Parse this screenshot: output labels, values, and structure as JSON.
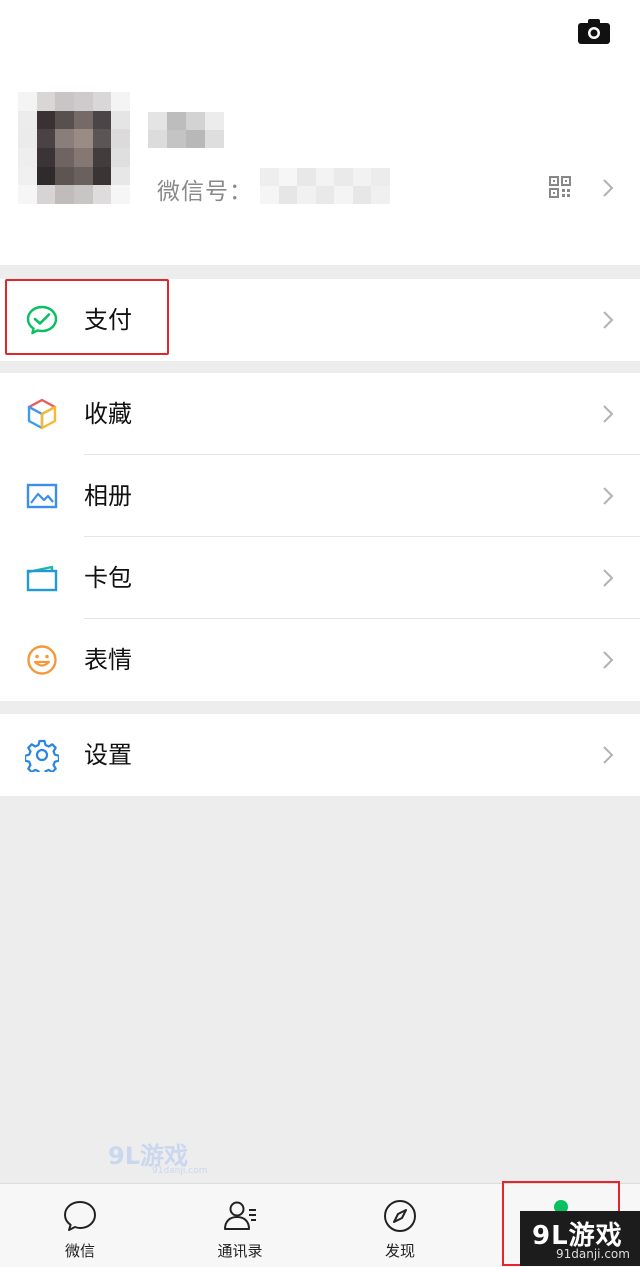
{
  "profile": {
    "wxid_label": "微信号：",
    "colors": {
      "background": "#ffffff"
    }
  },
  "pay_group": {
    "label": "支付"
  },
  "menu": {
    "items": [
      {
        "label": "收藏",
        "icon": "favorites-cube-icon"
      },
      {
        "label": "相册",
        "icon": "album-image-icon"
      },
      {
        "label": "卡包",
        "icon": "card-wallet-icon"
      },
      {
        "label": "表情",
        "icon": "sticker-smile-icon"
      }
    ]
  },
  "settings_group": {
    "label": "设置"
  },
  "tabbar": {
    "tabs": [
      {
        "label": "微信",
        "icon": "chat-bubble-icon"
      },
      {
        "label": "通讯录",
        "icon": "contacts-icon"
      },
      {
        "label": "发现",
        "icon": "compass-icon"
      }
    ]
  },
  "watermark": {
    "logo_text": "9L游戏",
    "logo_domain": "91danji.com",
    "corner_text": "9L游戏",
    "corner_domain": "91danji.com"
  },
  "colors": {
    "accent_green": "#07c160",
    "highlight_red": "#e2262b",
    "page_bg": "#ededed"
  }
}
